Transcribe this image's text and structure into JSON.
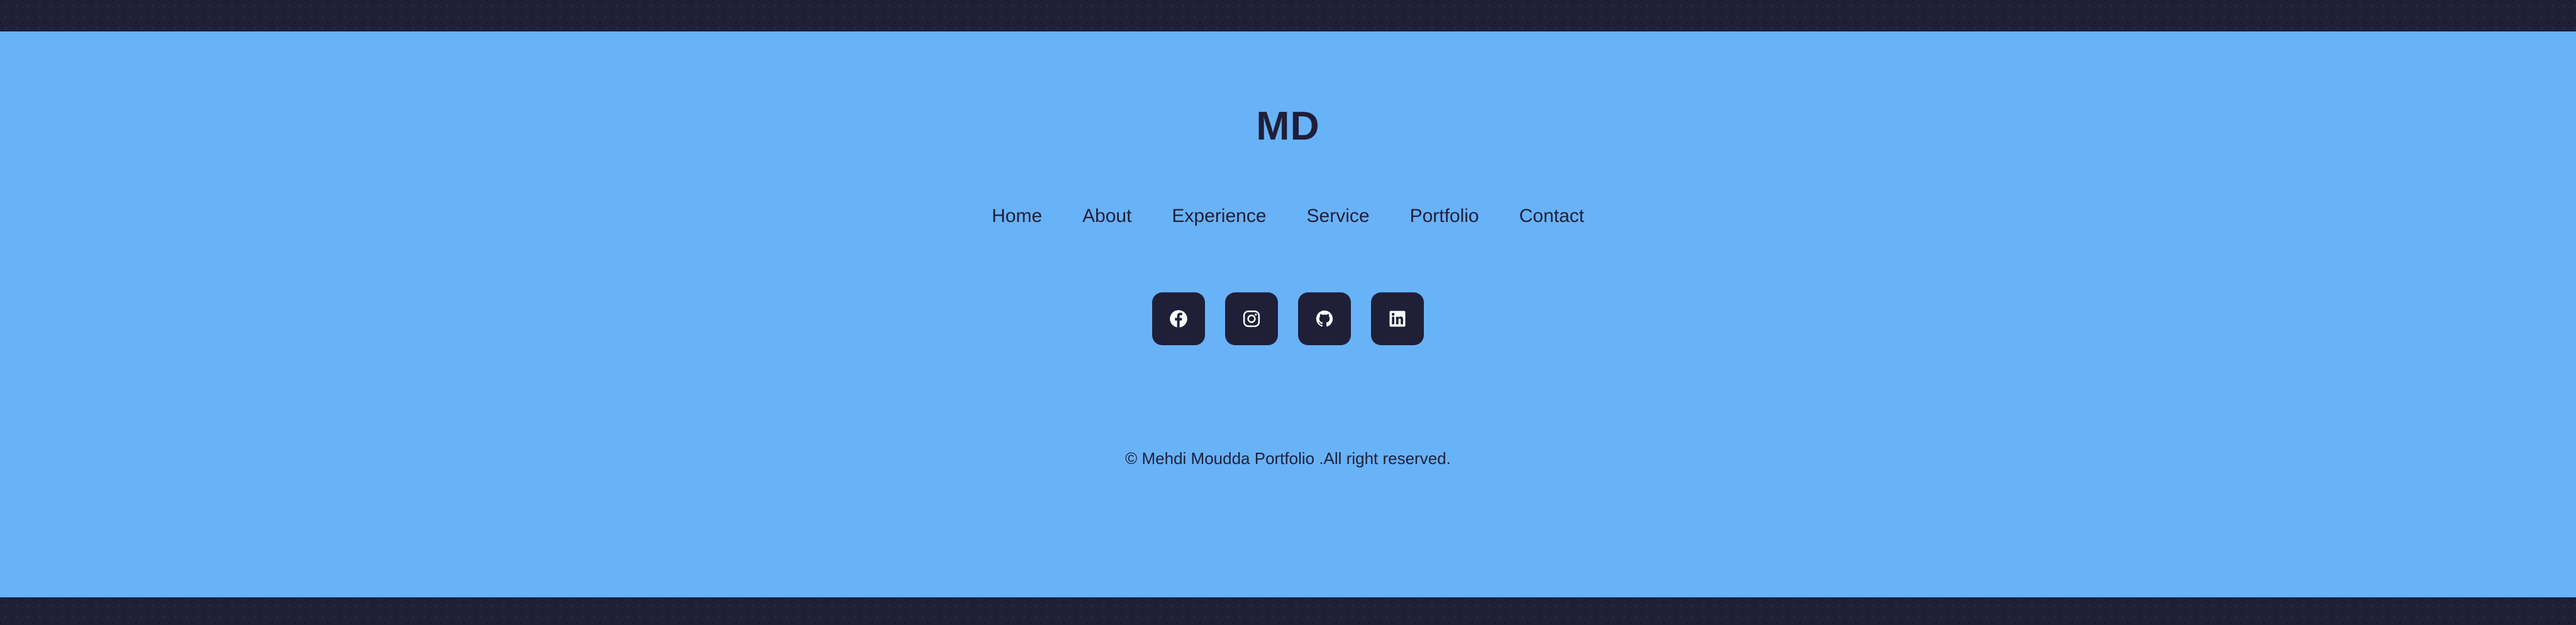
{
  "brand": {
    "logo": "MD"
  },
  "nav": {
    "items": [
      {
        "label": "Home"
      },
      {
        "label": "About"
      },
      {
        "label": "Experience"
      },
      {
        "label": "Service"
      },
      {
        "label": "Portfolio"
      },
      {
        "label": "Contact"
      }
    ]
  },
  "socials": [
    {
      "icon": "facebook-icon"
    },
    {
      "icon": "instagram-icon"
    },
    {
      "icon": "github-icon"
    },
    {
      "icon": "linkedin-icon"
    }
  ],
  "footer": {
    "copyright": "© Mehdi Moudda Portfolio .All right reserved."
  },
  "colors": {
    "background": "#1f1f38",
    "footer_background": "#68b2f8",
    "text": "#1f1f38",
    "icon": "#ffffff"
  }
}
